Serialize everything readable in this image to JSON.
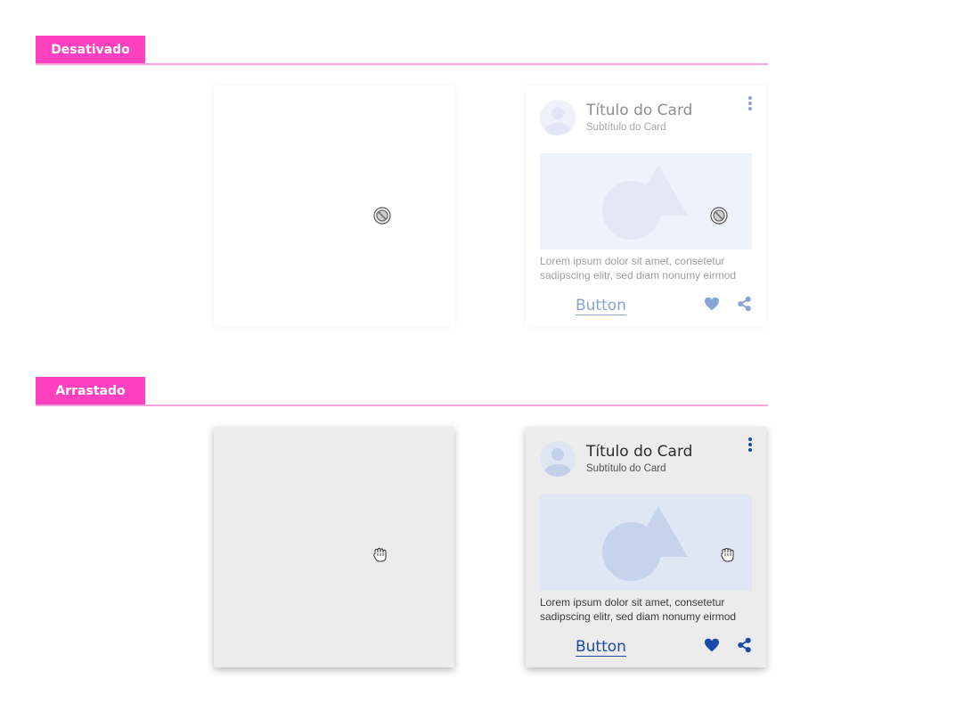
{
  "sections": [
    {
      "label": "Desativado",
      "card": {
        "title": "Título do Card",
        "subtitle": "Subtítulo do Card",
        "body": "Lorem ipsum dolor sit amet, consetetur sadipscing elitr, sed diam nonumy eirmod",
        "button_label": "Button"
      },
      "cursor_icon": "not-allowed-icon"
    },
    {
      "label": "Arrastado",
      "card": {
        "title": "Título do Card",
        "subtitle": "Subtítulo do Card",
        "body": "Lorem ipsum dolor sit amet, consetetur sadipscing elitr, sed diam nonumy eirmod",
        "button_label": "Button"
      },
      "cursor_icon": "grab-hand-icon"
    }
  ],
  "colors": {
    "section_tag": "#ff40c1",
    "section_line": "#f7a3dc",
    "primary": "#1d49a8",
    "primary_disabled": "#8aa3d3",
    "dragged_surface": "#ececec"
  }
}
